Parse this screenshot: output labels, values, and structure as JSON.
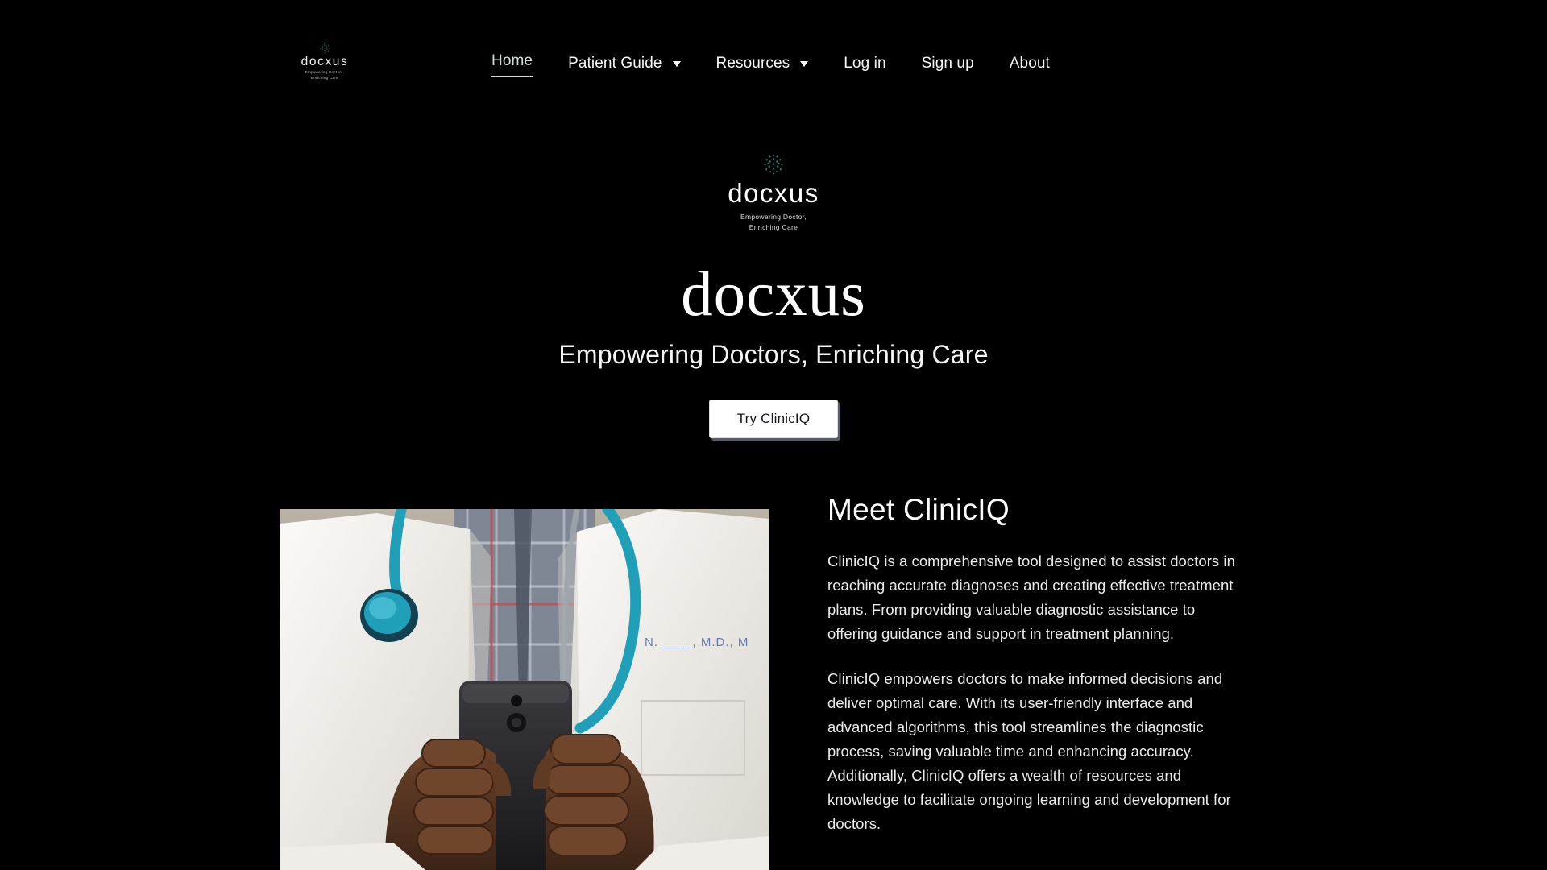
{
  "theme": {
    "background": "#000000",
    "text": "#ffffff",
    "accent": "#cfe0da",
    "logo_dot": "#2e7f72",
    "cta_bg": "#ffffff",
    "cta_text": "#15171a",
    "photo_backdrop": "#b7b0a3",
    "coat_white": "#f3f1ec",
    "stethoscope": "#1f9fb8",
    "skin": "#5a3725",
    "phone": "#2b2b2d"
  },
  "header": {
    "logo": {
      "mark_name": "docxus-dot-cluster-mark",
      "wordmark": "docxus",
      "tagline": "Empowering Doctors,\nEnriching Care"
    },
    "nav": [
      {
        "label": "Home",
        "active": true,
        "has_dropdown": false
      },
      {
        "label": "Patient Guide",
        "active": false,
        "has_dropdown": true
      },
      {
        "label": "Resources",
        "active": false,
        "has_dropdown": true
      },
      {
        "label": "Log in",
        "active": false,
        "has_dropdown": false
      },
      {
        "label": "Sign up",
        "active": false,
        "has_dropdown": false
      },
      {
        "label": "About",
        "active": false,
        "has_dropdown": false
      }
    ]
  },
  "hero": {
    "logo": {
      "mark_name": "docxus-dot-cluster-mark",
      "wordmark": "docxus",
      "tagline": "Empowering Doctor,\nEnriching Care"
    },
    "title": "docxus",
    "subtitle": "Empowering Doctors, Enriching Care",
    "cta_label": "Try ClinicIQ"
  },
  "meet": {
    "heading": "Meet ClinicIQ",
    "photo_alt": "doctor-in-white-coat-holding-smartphone",
    "paragraphs": [
      "ClinicIQ is a comprehensive tool designed to assist doctors in reaching accurate diagnoses and creating effective treatment plans. From providing valuable diagnostic assistance to offering guidance and support in treatment planning.",
      "ClinicIQ empowers doctors to make informed decisions and deliver optimal care. With its user-friendly interface and advanced algorithms, this tool streamlines the diagnostic process, saving valuable time and enhancing accuracy. Additionally, ClinicIQ offers a wealth of resources and knowledge to facilitate ongoing learning and development for doctors."
    ]
  }
}
